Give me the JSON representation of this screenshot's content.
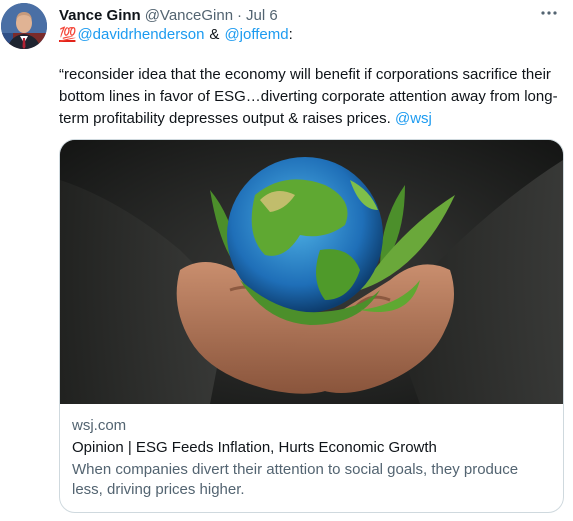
{
  "tweet": {
    "display_name": "Vance Ginn",
    "handle": "@VanceGinn",
    "separator": "·",
    "date": "Jul 6",
    "more_icon": "more-dots-icon",
    "reply_emoji": "💯",
    "mention_1": "@davidrhenderson",
    "amp": "&",
    "mention_2": "@joffemd",
    "mention_suffix": ":",
    "body": "“reconsider idea that the economy will benefit if corporations sacrifice their bottom lines in favor of ESG…diverting corporate attention away from long-term profitability depresses output & raises prices.",
    "body_link": "@wsj"
  },
  "card": {
    "domain": "wsj.com",
    "title": "Opinion | ESG Feeds Inflation, Hurts Economic Growth",
    "description": "When companies divert their attention to social goals, they produce less, driving prices higher."
  },
  "colors": {
    "link": "#1d9bf0",
    "secondary_text": "#536471",
    "border": "#cfd9de"
  }
}
